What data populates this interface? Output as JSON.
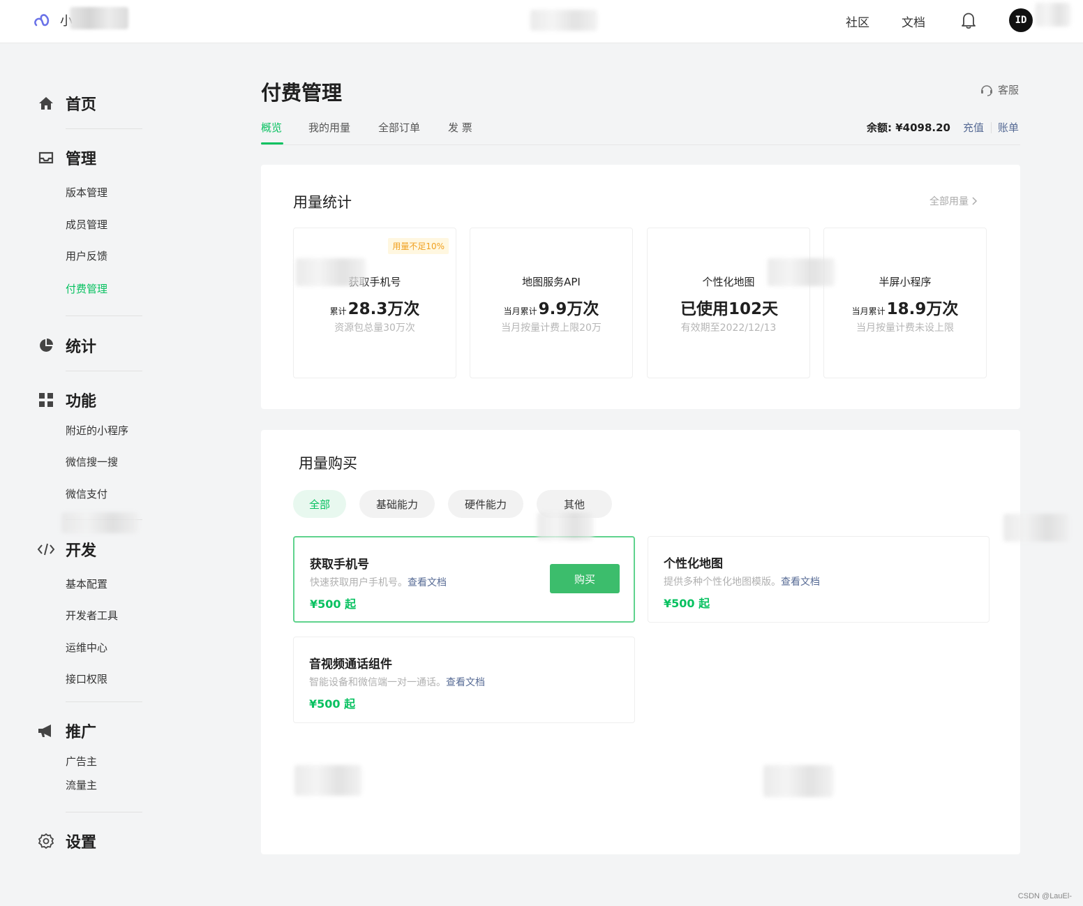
{
  "topbar": {
    "app_name_prefix": "小",
    "nav": [
      "社区",
      "文档"
    ],
    "avatar_text": "ID"
  },
  "sidebar": {
    "groups": [
      {
        "label": "首页",
        "icon": "home-icon",
        "items": []
      },
      {
        "label": "管理",
        "icon": "inbox-icon",
        "items": [
          "版本管理",
          "成员管理",
          "用户反馈",
          "付费管理"
        ]
      },
      {
        "label": "统计",
        "icon": "pie-chart-icon",
        "items": []
      },
      {
        "label": "功能",
        "icon": "grid-icon",
        "items": [
          "附近的小程序",
          "微信搜一搜",
          "微信支付"
        ]
      },
      {
        "label": "开发",
        "icon": "code-icon",
        "items": [
          "基本配置",
          "开发者工具",
          "运维中心",
          "接口权限"
        ]
      },
      {
        "label": "推广",
        "icon": "megaphone-icon",
        "items": [
          "广告主",
          "流量主"
        ]
      },
      {
        "label": "设置",
        "icon": "gear-icon",
        "items": []
      }
    ],
    "active_item": "付费管理"
  },
  "main": {
    "title": "付费管理",
    "service": "客服",
    "tabs": [
      "概览",
      "我的用量",
      "全部订单",
      "发 票"
    ],
    "balance_label": "余额:",
    "balance_value": "¥4098.20",
    "recharge": "充值",
    "bill": "账单",
    "usage_stats": {
      "title": "用量统计",
      "all_link": "全部用量",
      "cards": [
        {
          "badge": "用量不足10%",
          "name": "获取手机号",
          "prefix": "累计",
          "value": "28.3万次",
          "note": "资源包总量30万次"
        },
        {
          "badge": "",
          "name": "地图服务API",
          "prefix": "当月累计",
          "value": "9.9万次",
          "note": "当月按量计费上限20万"
        },
        {
          "badge": "",
          "name": "个性化地图",
          "prefix": "",
          "value": "已使用102天",
          "note": "有效期至2022/12/13"
        },
        {
          "badge": "",
          "name": "半屏小程序",
          "prefix": "当月累计",
          "value": "18.9万次",
          "note": "当月按量计费未设上限"
        }
      ]
    },
    "purchase": {
      "title": "用量购买",
      "filters": [
        "全部",
        "基础能力",
        "硬件能力",
        "其他"
      ],
      "buy_label": "购买",
      "doc_link": "查看文档",
      "products": [
        {
          "name": "获取手机号",
          "desc": "快速获取用户手机号。",
          "price": "¥500 起"
        },
        {
          "name": "个性化地图",
          "desc": "提供多种个性化地图模版。",
          "price": "¥500 起"
        },
        {
          "name": "音视频通话组件",
          "desc": "智能设备和微信端一对一通话。",
          "price": "¥500 起"
        }
      ]
    }
  },
  "watermark": "CSDN @LauEl-",
  "colors": {
    "accent": "#07c160",
    "link": "#576b95",
    "warn": "#f0a020"
  }
}
